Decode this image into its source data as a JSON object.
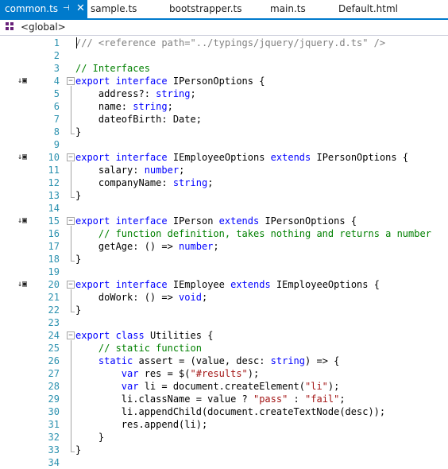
{
  "tabs": [
    {
      "label": "common.ts",
      "active": true,
      "pin_icon": "pin-icon",
      "close_icon": "close-icon"
    },
    {
      "label": "sample.ts",
      "active": false
    },
    {
      "label": "bootstrapper.ts",
      "active": false
    },
    {
      "label": "main.ts",
      "active": false
    },
    {
      "label": "Default.html",
      "active": false
    }
  ],
  "navigation": {
    "scope_icon": "namespace-icon",
    "scope": "<global>"
  },
  "colors": {
    "accent": "#007acc",
    "keyword": "#0000ff",
    "comment": "#008000",
    "string": "#a31515",
    "line_number": "#2b91af"
  },
  "gutter_icons": [
    "implementation-glyph-icon"
  ],
  "code_lines": [
    {
      "n": "1",
      "tokens": [
        [
          "ref",
          "/// <reference path=\"../typings/jquery/jquery.d.ts\" />"
        ]
      ]
    },
    {
      "n": "2",
      "tokens": []
    },
    {
      "n": "3",
      "tokens": [
        [
          "cm",
          "// Interfaces"
        ]
      ]
    },
    {
      "n": "4",
      "glyph": true,
      "fold": true,
      "tokens": [
        [
          "kw",
          "export"
        ],
        [
          "",
          " "
        ],
        [
          "kw",
          "interface"
        ],
        [
          "",
          " IPersonOptions {"
        ]
      ]
    },
    {
      "n": "5",
      "tokens": [
        [
          "",
          "    address?: "
        ],
        [
          "kw",
          "string"
        ],
        [
          "",
          ";"
        ]
      ]
    },
    {
      "n": "6",
      "tokens": [
        [
          "",
          "    name: "
        ],
        [
          "kw",
          "string"
        ],
        [
          "",
          ";"
        ]
      ]
    },
    {
      "n": "7",
      "tokens": [
        [
          "",
          "    dateofBirth: Date;"
        ]
      ]
    },
    {
      "n": "8",
      "tokens": [
        [
          "",
          "}"
        ]
      ]
    },
    {
      "n": "9",
      "tokens": []
    },
    {
      "n": "10",
      "glyph": true,
      "fold": true,
      "tokens": [
        [
          "kw",
          "export"
        ],
        [
          "",
          " "
        ],
        [
          "kw",
          "interface"
        ],
        [
          "",
          " IEmployeeOptions "
        ],
        [
          "kw",
          "extends"
        ],
        [
          "",
          " IPersonOptions {"
        ]
      ]
    },
    {
      "n": "11",
      "tokens": [
        [
          "",
          "    salary: "
        ],
        [
          "kw",
          "number"
        ],
        [
          "",
          ";"
        ]
      ]
    },
    {
      "n": "12",
      "tokens": [
        [
          "",
          "    companyName: "
        ],
        [
          "kw",
          "string"
        ],
        [
          "",
          ";"
        ]
      ]
    },
    {
      "n": "13",
      "tokens": [
        [
          "",
          "}"
        ]
      ]
    },
    {
      "n": "14",
      "tokens": []
    },
    {
      "n": "15",
      "glyph": true,
      "fold": true,
      "tokens": [
        [
          "kw",
          "export"
        ],
        [
          "",
          " "
        ],
        [
          "kw",
          "interface"
        ],
        [
          "",
          " IPerson "
        ],
        [
          "kw",
          "extends"
        ],
        [
          "",
          " IPersonOptions {"
        ]
      ]
    },
    {
      "n": "16",
      "tokens": [
        [
          "",
          "    "
        ],
        [
          "cm",
          "// function definition, takes nothing and returns a number"
        ]
      ]
    },
    {
      "n": "17",
      "tokens": [
        [
          "",
          "    getAge: () => "
        ],
        [
          "kw",
          "number"
        ],
        [
          "",
          ";"
        ]
      ]
    },
    {
      "n": "18",
      "tokens": [
        [
          "",
          "}"
        ]
      ]
    },
    {
      "n": "19",
      "tokens": []
    },
    {
      "n": "20",
      "glyph": true,
      "fold": true,
      "tokens": [
        [
          "kw",
          "export"
        ],
        [
          "",
          " "
        ],
        [
          "kw",
          "interface"
        ],
        [
          "",
          " IEmployee "
        ],
        [
          "kw",
          "extends"
        ],
        [
          "",
          " IEmployeeOptions {"
        ]
      ]
    },
    {
      "n": "21",
      "tokens": [
        [
          "",
          "    doWork: () => "
        ],
        [
          "kw",
          "void"
        ],
        [
          "",
          ";"
        ]
      ]
    },
    {
      "n": "22",
      "tokens": [
        [
          "",
          "}"
        ]
      ]
    },
    {
      "n": "23",
      "tokens": []
    },
    {
      "n": "24",
      "fold": true,
      "tokens": [
        [
          "kw",
          "export"
        ],
        [
          "",
          " "
        ],
        [
          "kw",
          "class"
        ],
        [
          "",
          " Utilities {"
        ]
      ]
    },
    {
      "n": "25",
      "tokens": [
        [
          "",
          "    "
        ],
        [
          "cm",
          "// static function"
        ]
      ]
    },
    {
      "n": "26",
      "tokens": [
        [
          "",
          "    "
        ],
        [
          "kw",
          "static"
        ],
        [
          "",
          " assert = (value, desc: "
        ],
        [
          "kw",
          "string"
        ],
        [
          "",
          ") => {"
        ]
      ]
    },
    {
      "n": "27",
      "tokens": [
        [
          "",
          "        "
        ],
        [
          "kw",
          "var"
        ],
        [
          "",
          " res = $("
        ],
        [
          "str",
          "\"#results\""
        ],
        [
          "",
          ");"
        ]
      ]
    },
    {
      "n": "28",
      "tokens": [
        [
          "",
          "        "
        ],
        [
          "kw",
          "var"
        ],
        [
          "",
          " li = document.createElement("
        ],
        [
          "str",
          "\"li\""
        ],
        [
          "",
          ");"
        ]
      ]
    },
    {
      "n": "29",
      "tokens": [
        [
          "",
          "        li.className = value ? "
        ],
        [
          "str",
          "\"pass\""
        ],
        [
          "",
          " : "
        ],
        [
          "str",
          "\"fail\""
        ],
        [
          "",
          ";"
        ]
      ]
    },
    {
      "n": "30",
      "tokens": [
        [
          "",
          "        li.appendChild(document.createTextNode(desc));"
        ]
      ]
    },
    {
      "n": "31",
      "tokens": [
        [
          "",
          "        res.append(li);"
        ]
      ]
    },
    {
      "n": "32",
      "tokens": [
        [
          "",
          "    }"
        ]
      ]
    },
    {
      "n": "33",
      "tokens": [
        [
          "",
          "}"
        ]
      ]
    },
    {
      "n": "34",
      "tokens": []
    }
  ]
}
